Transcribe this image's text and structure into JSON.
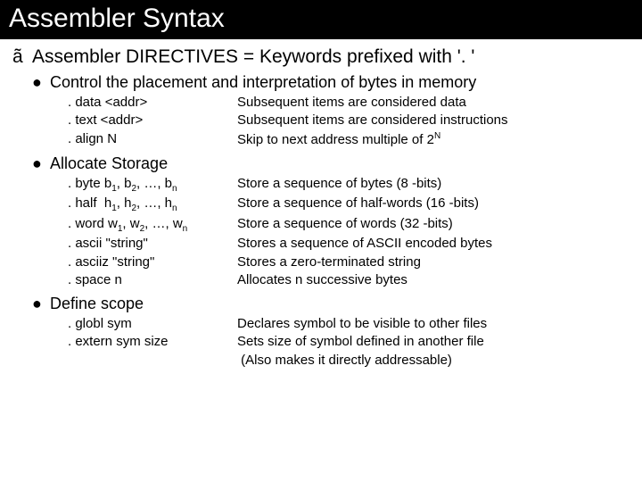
{
  "title": "Assembler Syntax",
  "main_bullet": "ã",
  "main_text": "Assembler DIRECTIVES = Keywords prefixed with '. '",
  "sections": [
    {
      "heading": "Control the placement and interpretation of bytes in memory",
      "rows": [
        {
          "l": ". data <addr>",
          "r": "Subsequent items are considered data"
        },
        {
          "l": ". text <addr>",
          "r": "Subsequent items are considered instructions"
        },
        {
          "l": ". align N",
          "r": "Skip to next address multiple of 2",
          "rsup": "N"
        }
      ]
    },
    {
      "heading": "Allocate Storage",
      "rows": [
        {
          "l_html": ". byte b<sub>1</sub>, b<sub>2</sub>, …, b<sub>n</sub>",
          "r": "Store a sequence of bytes (8 -bits)"
        },
        {
          "l_html": ". half  h<sub>1</sub>, h<sub>2</sub>, …, h<sub>n</sub>",
          "r": "Store a sequence of half-words (16 -bits)"
        },
        {
          "l_html": ". word w<sub>1</sub>, w<sub>2</sub>, …, w<sub>n</sub>",
          "r": "Store a sequence of words (32 -bits)"
        },
        {
          "l": ". ascii \"string\"",
          "r": "Stores a sequence of ASCII encoded bytes"
        },
        {
          "l": ". asciiz \"string\"",
          "r": "Stores a zero-terminated string"
        },
        {
          "l": ". space n",
          "r": "Allocates n successive bytes"
        }
      ]
    },
    {
      "heading": "Define scope",
      "rows": [
        {
          "l": ". globl sym",
          "r": "Declares symbol to be visible to other files"
        },
        {
          "l": ". extern sym size",
          "r": "Sets size of symbol defined in another file\n (Also makes it directly addressable)"
        }
      ]
    }
  ]
}
